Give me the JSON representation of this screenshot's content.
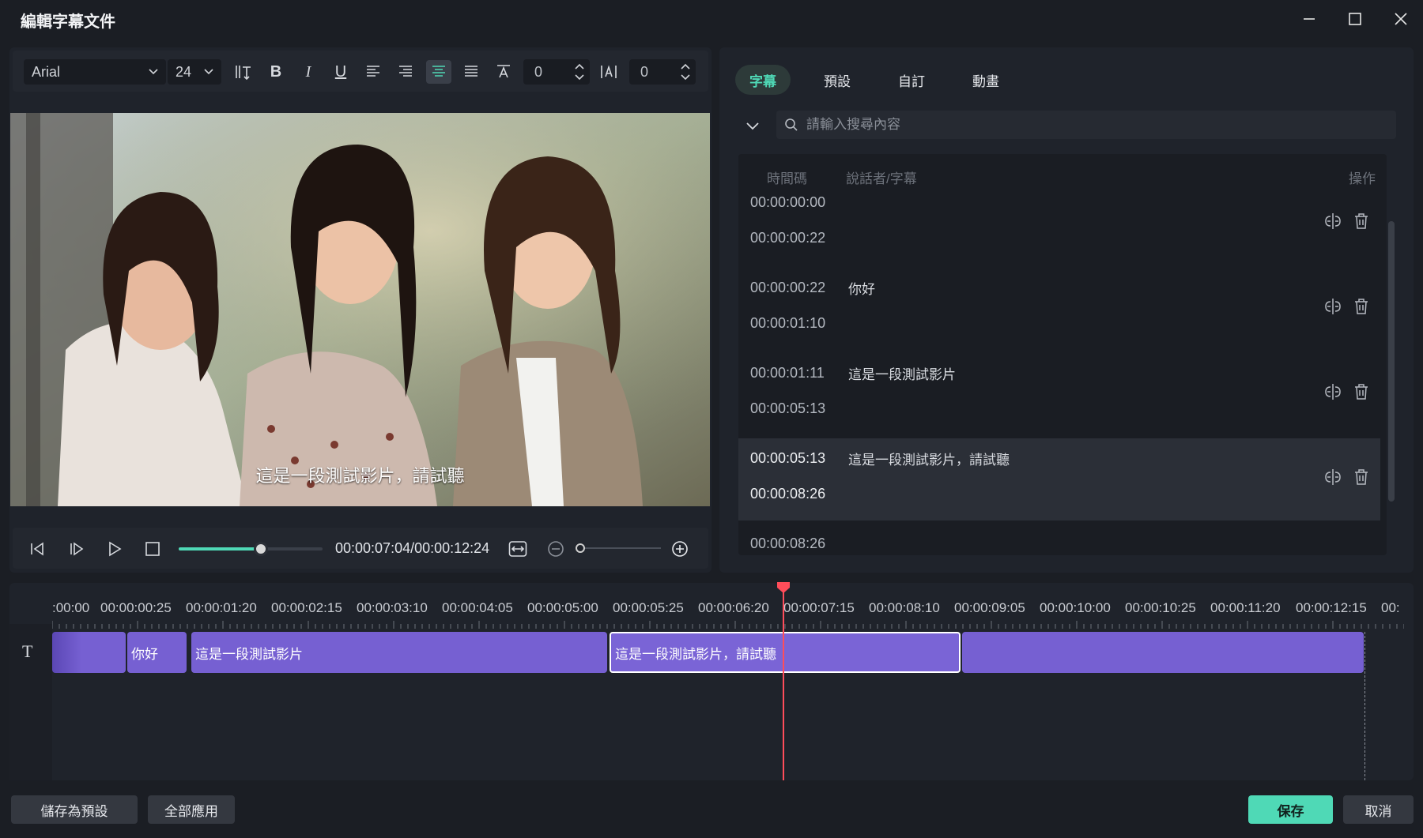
{
  "window": {
    "title": "編輯字幕文件"
  },
  "toolbar": {
    "font": "Arial",
    "size": "24",
    "spacing_value": "0",
    "line_spacing_value": "0"
  },
  "player": {
    "subtitle": "這是一段測試影片，請試聽",
    "timecode": "00:00:07:04/00:00:12:24",
    "progress": 0.57,
    "zoom": 0.0
  },
  "tabs": [
    {
      "label": "字幕",
      "active": true
    },
    {
      "label": "預設",
      "active": false
    },
    {
      "label": "自訂",
      "active": false
    },
    {
      "label": "動畫",
      "active": false
    }
  ],
  "search": {
    "placeholder": "請輸入搜尋內容",
    "value": ""
  },
  "list": {
    "headers": {
      "time": "時間碼",
      "speaker": "說話者/字幕",
      "action": "操作"
    },
    "rows": [
      {
        "start": "00:00:00:00",
        "end": "00:00:00:22",
        "text": ""
      },
      {
        "start": "00:00:00:22",
        "end": "00:00:01:10",
        "text": "你好"
      },
      {
        "start": "00:00:01:11",
        "end": "00:00:05:13",
        "text": "這是一段測試影片"
      },
      {
        "start": "00:00:05:13",
        "end": "00:00:08:26",
        "text": "這是一段測試影片，請試聽"
      },
      {
        "start": "00:00:08:26",
        "end": "",
        "text": ""
      }
    ]
  },
  "timeline": {
    "ruler": [
      ":00:00",
      "00:00:00:25",
      "00:00:01:20",
      "00:00:02:15",
      "00:00:03:10",
      "00:00:04:05",
      "00:00:05:00",
      "00:00:05:25",
      "00:00:06:20",
      "00:00:07:15",
      "00:00:08:10",
      "00:00:09:05",
      "00:00:10:00",
      "00:00:10:25",
      "00:00:11:20",
      "00:00:12:15",
      "00:"
    ],
    "clips": [
      "",
      "你好",
      "這是一段測試影片",
      "這是一段測試影片，請試聽",
      ""
    ],
    "playhead": "00:00:07:04"
  },
  "buttons": {
    "save_preset": "儲存為預設",
    "apply_all": "全部應用",
    "save": "保存",
    "cancel": "取消"
  },
  "colors": {
    "accent": "#4fd9b6",
    "clip": "#7660d2",
    "playhead": "#ff4d5a"
  }
}
